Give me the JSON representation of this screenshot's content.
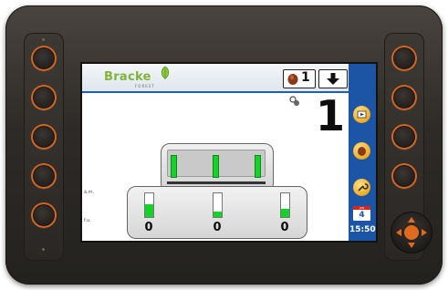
{
  "screen": {
    "logo": {
      "brand": "Bracke",
      "sub": "FOREST"
    },
    "top_tiles": {
      "count_value": "1"
    },
    "big_number": "1",
    "axis_labels": {
      "upper": "ä.m.",
      "lower": "f.u."
    },
    "sections": [
      {
        "value": "0",
        "level": 0.55
      },
      {
        "value": "0",
        "level": 0.25
      },
      {
        "value": "0",
        "level": 0.35
      }
    ],
    "sidebar": {
      "calendar_month": "JUN",
      "calendar_day": "4",
      "time": "15:50"
    }
  },
  "colors": {
    "accent_orange": "#d46622",
    "sidebar_blue": "#1c55a6",
    "indicator_green": "#16d12a",
    "logo_green": "#7fb53a"
  }
}
